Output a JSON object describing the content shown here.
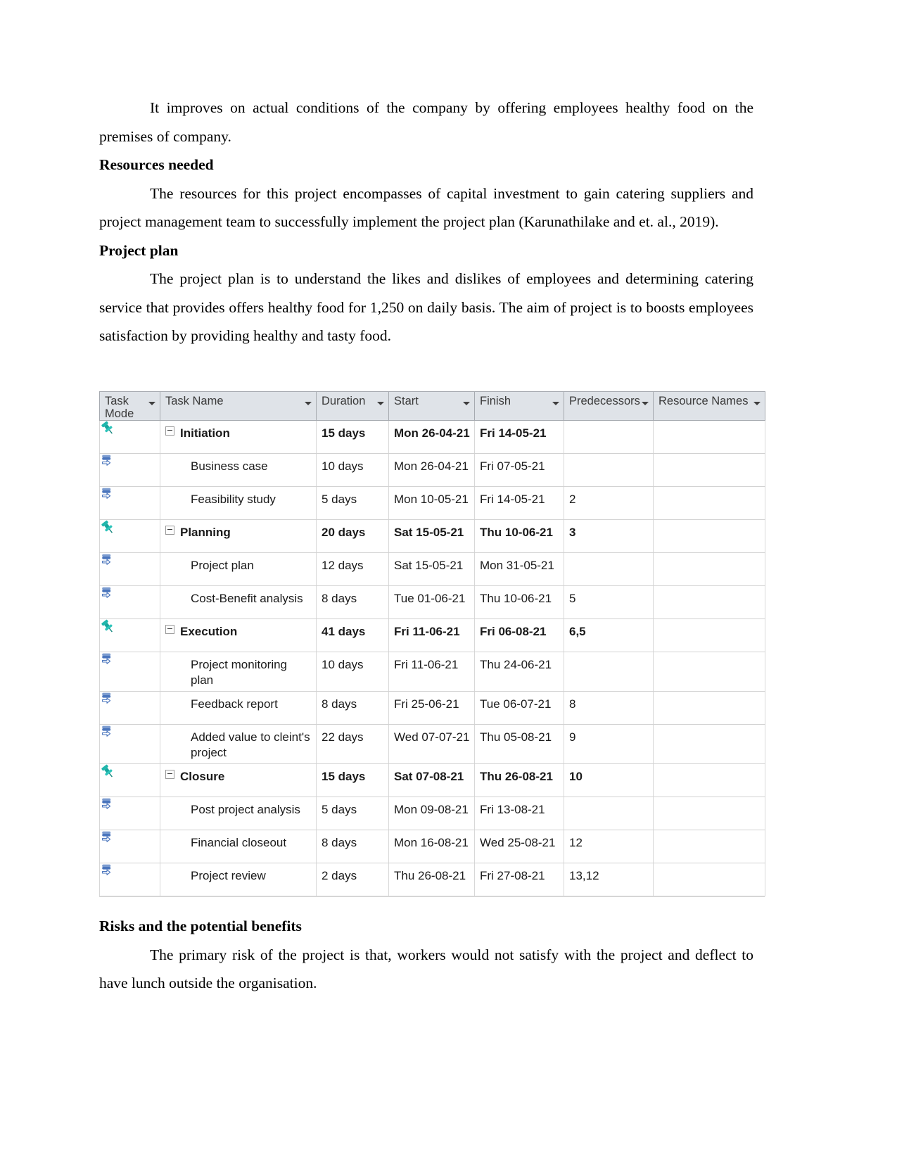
{
  "document": {
    "paragraphs": {
      "intro": "It improves on actual conditions of the company by offering employees healthy food on the premises of company.",
      "resources_heading": "Resources needed",
      "resources_body": "The resources for this project encompasses of capital investment to gain catering suppliers and project management team to successfully implement the project plan (Karunathilake and et. al., 2019).",
      "project_plan_heading": "Project plan",
      "project_plan_body": "The project plan is to understand the likes and dislikes of employees and determining catering service that provides offers healthy food for 1,250 on daily basis. The aim of project is to boosts employees satisfaction by providing healthy and tasty food.",
      "risks_heading": "Risks and the potential benefits",
      "risks_body": "The primary risk of the project is that, workers would not satisfy with the project and deflect to have lunch outside the organisation."
    }
  },
  "project_table": {
    "columns": [
      {
        "id": "task_mode",
        "label": "Task Mode",
        "has_filter": true,
        "highlighted": false
      },
      {
        "id": "task_name",
        "label": "Task Name",
        "has_filter": true,
        "highlighted": false
      },
      {
        "id": "duration",
        "label": "Duration",
        "has_filter": true,
        "highlighted": false
      },
      {
        "id": "start",
        "label": "Start",
        "has_filter": true,
        "highlighted": false
      },
      {
        "id": "finish",
        "label": "Finish",
        "has_filter": true,
        "highlighted": false
      },
      {
        "id": "predecessors",
        "label": "Predecessors",
        "has_filter": true,
        "highlighted": true
      },
      {
        "id": "resource_names",
        "label": "Resource Names",
        "has_filter": true,
        "highlighted": false
      }
    ],
    "highlight_color": "#ffcf53",
    "header_background": "#dfe3e8",
    "rows": [
      {
        "mode_icon": "pushpin-icon",
        "type": "summary",
        "name": "Initiation",
        "duration": "15 days",
        "start": "Mon 26-04-21",
        "finish": "Fri 14-05-21",
        "predecessors": "",
        "resource_names": ""
      },
      {
        "mode_icon": "auto-schedule-icon",
        "type": "task",
        "name": "Business case",
        "duration": "10 days",
        "start": "Mon 26-04-21",
        "finish": "Fri 07-05-21",
        "predecessors": "",
        "resource_names": ""
      },
      {
        "mode_icon": "auto-schedule-icon",
        "type": "task",
        "name": "Feasibility study",
        "duration": "5 days",
        "start": "Mon 10-05-21",
        "finish": "Fri 14-05-21",
        "predecessors": "2",
        "resource_names": ""
      },
      {
        "mode_icon": "pushpin-icon",
        "type": "summary",
        "name": "Planning",
        "duration": "20 days",
        "start": "Sat 15-05-21",
        "finish": "Thu 10-06-21",
        "predecessors": "3",
        "resource_names": ""
      },
      {
        "mode_icon": "auto-schedule-icon",
        "type": "task",
        "name": "Project plan",
        "duration": "12 days",
        "start": "Sat 15-05-21",
        "finish": "Mon 31-05-21",
        "predecessors": "",
        "resource_names": ""
      },
      {
        "mode_icon": "auto-schedule-icon",
        "type": "task",
        "name": "Cost-Benefit analysis",
        "duration": "8 days",
        "start": "Tue 01-06-21",
        "finish": "Thu 10-06-21",
        "predecessors": "5",
        "resource_names": ""
      },
      {
        "mode_icon": "pushpin-icon",
        "type": "summary",
        "name": "Execution",
        "duration": "41 days",
        "start": "Fri 11-06-21",
        "finish": "Fri 06-08-21",
        "predecessors": "6,5",
        "resource_names": ""
      },
      {
        "mode_icon": "auto-schedule-icon",
        "type": "task",
        "name": "Project monitoring plan",
        "duration": "10 days",
        "start": "Fri 11-06-21",
        "finish": "Thu 24-06-21",
        "predecessors": "",
        "resource_names": ""
      },
      {
        "mode_icon": "auto-schedule-icon",
        "type": "task",
        "name": "Feedback report",
        "duration": "8 days",
        "start": "Fri 25-06-21",
        "finish": "Tue 06-07-21",
        "predecessors": "8",
        "resource_names": ""
      },
      {
        "mode_icon": "auto-schedule-icon",
        "type": "task",
        "name": "Added value to cleint's project",
        "duration": "22 days",
        "start": "Wed 07-07-21",
        "finish": "Thu 05-08-21",
        "predecessors": "9",
        "resource_names": ""
      },
      {
        "mode_icon": "pushpin-icon",
        "type": "summary",
        "name": "Closure",
        "duration": "15 days",
        "start": "Sat 07-08-21",
        "finish": "Thu 26-08-21",
        "predecessors": "10",
        "resource_names": ""
      },
      {
        "mode_icon": "auto-schedule-icon",
        "type": "task",
        "name": "Post project analysis",
        "duration": "5 days",
        "start": "Mon 09-08-21",
        "finish": "Fri 13-08-21",
        "predecessors": "",
        "resource_names": ""
      },
      {
        "mode_icon": "auto-schedule-icon",
        "type": "task",
        "name": "Financial closeout",
        "duration": "8 days",
        "start": "Mon 16-08-21",
        "finish": "Wed 25-08-21",
        "predecessors": "12",
        "resource_names": ""
      },
      {
        "mode_icon": "auto-schedule-icon",
        "type": "task",
        "name": "Project review",
        "duration": "2 days",
        "start": "Thu 26-08-21",
        "finish": "Fri 27-08-21",
        "predecessors": "13,12",
        "resource_names": ""
      }
    ]
  }
}
